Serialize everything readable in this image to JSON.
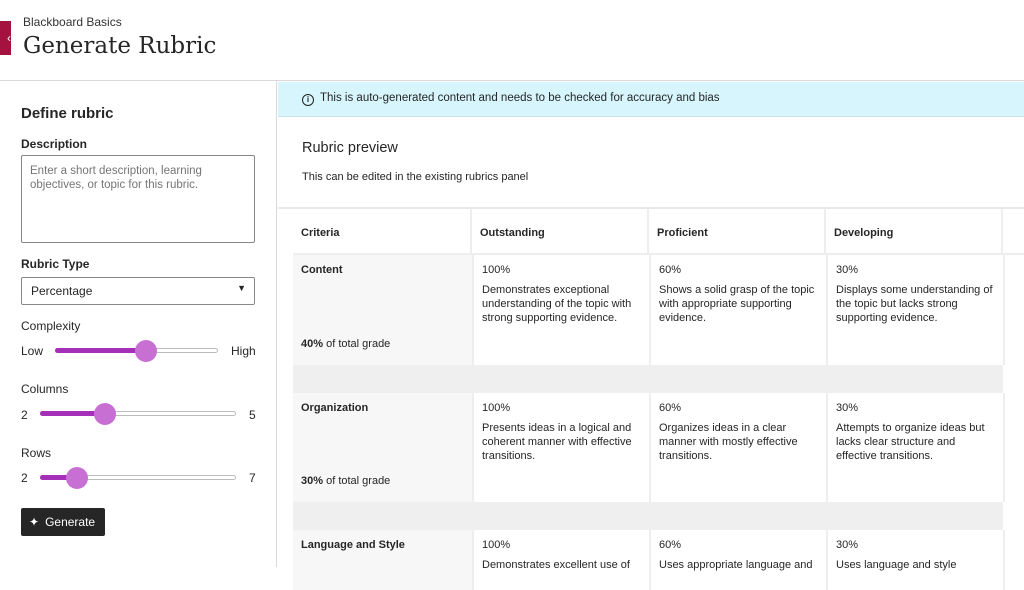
{
  "header": {
    "breadcrumb": "Blackboard Basics",
    "title": "Generate Rubric",
    "back_icon": "chevron-left-icon",
    "accent": "#a5123f"
  },
  "form": {
    "heading": "Define rubric",
    "description_label": "Description",
    "description_value": "",
    "description_placeholder": "Enter a short description, learning objectives, or topic for this rubric.",
    "type_label": "Rubric Type",
    "type_value": "Percentage",
    "complexity": {
      "label": "Complexity",
      "min_label": "Low",
      "max_label": "High",
      "value_fraction": 0.56
    },
    "columns": {
      "label": "Columns",
      "min": "2",
      "max": "5",
      "value": 3
    },
    "rows": {
      "label": "Rows",
      "min": "2",
      "max": "7",
      "value": 3
    },
    "generate_label": "Generate",
    "slider_color": "#a52fb8"
  },
  "banner": {
    "text": "This is auto-generated content and needs to be checked for accuracy and bias",
    "color": "#d6f5fc"
  },
  "preview": {
    "title": "Rubric preview",
    "subtitle": "This can be edited in the existing rubrics panel",
    "headers": [
      "Criteria",
      "Outstanding",
      "Proficient",
      "Developing"
    ],
    "rows": [
      {
        "criterion": "Content",
        "weight": "40%",
        "weight_suffix": " of total grade",
        "cells": [
          {
            "pct": "100%",
            "text": "Demonstrates exceptional understanding of the topic with strong supporting evidence."
          },
          {
            "pct": "60%",
            "text": "Shows a solid grasp of the topic with appropriate supporting evidence."
          },
          {
            "pct": "30%",
            "text": "Displays some understanding of the topic but lacks strong supporting evidence."
          }
        ]
      },
      {
        "criterion": "Organization",
        "weight": "30%",
        "weight_suffix": " of total grade",
        "cells": [
          {
            "pct": "100%",
            "text": "Presents ideas in a logical and coherent manner with effective transitions."
          },
          {
            "pct": "60%",
            "text": "Organizes ideas in a clear manner with mostly effective transitions."
          },
          {
            "pct": "30%",
            "text": "Attempts to organize ideas but lacks clear structure and effective transitions."
          }
        ]
      },
      {
        "criterion": "Language and Style",
        "cells": [
          {
            "pct": "100%",
            "text": "Demonstrates excellent use of"
          },
          {
            "pct": "60%",
            "text": "Uses appropriate language and"
          },
          {
            "pct": "30%",
            "text": "Uses language and style"
          }
        ]
      }
    ]
  }
}
